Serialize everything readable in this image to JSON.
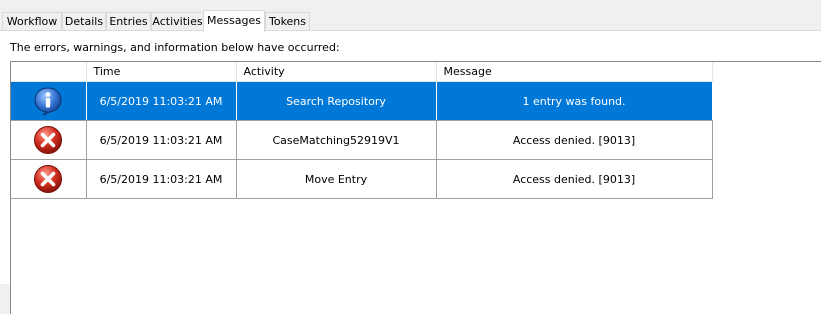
{
  "tabs": [
    {
      "label": "Workflow"
    },
    {
      "label": "Details"
    },
    {
      "label": "Entries"
    },
    {
      "label": "Activities"
    },
    {
      "label": "Messages"
    },
    {
      "label": "Tokens"
    }
  ],
  "active_tab": "Messages",
  "panel": {
    "description": "The errors, warnings, and information below have occurred:"
  },
  "grid": {
    "columns": [
      "",
      "Time",
      "Activity",
      "Message"
    ],
    "rows": [
      {
        "icon": "info-icon",
        "time": "6/5/2019 11:03:21 AM",
        "activity": "Search Repository",
        "message": "1 entry was found.",
        "selected": true
      },
      {
        "icon": "error-icon",
        "time": "6/5/2019 11:03:21 AM",
        "activity": "CaseMatching52919V1",
        "message": "Access denied. [9013]",
        "selected": false
      },
      {
        "icon": "error-icon",
        "time": "6/5/2019 11:03:21 AM",
        "activity": "Move Entry",
        "message": "Access denied. [9013]",
        "selected": false
      }
    ]
  },
  "colors": {
    "selection": "#0078d7",
    "info_icon": "#1a5fb4",
    "error_icon": "#c42b1c"
  }
}
